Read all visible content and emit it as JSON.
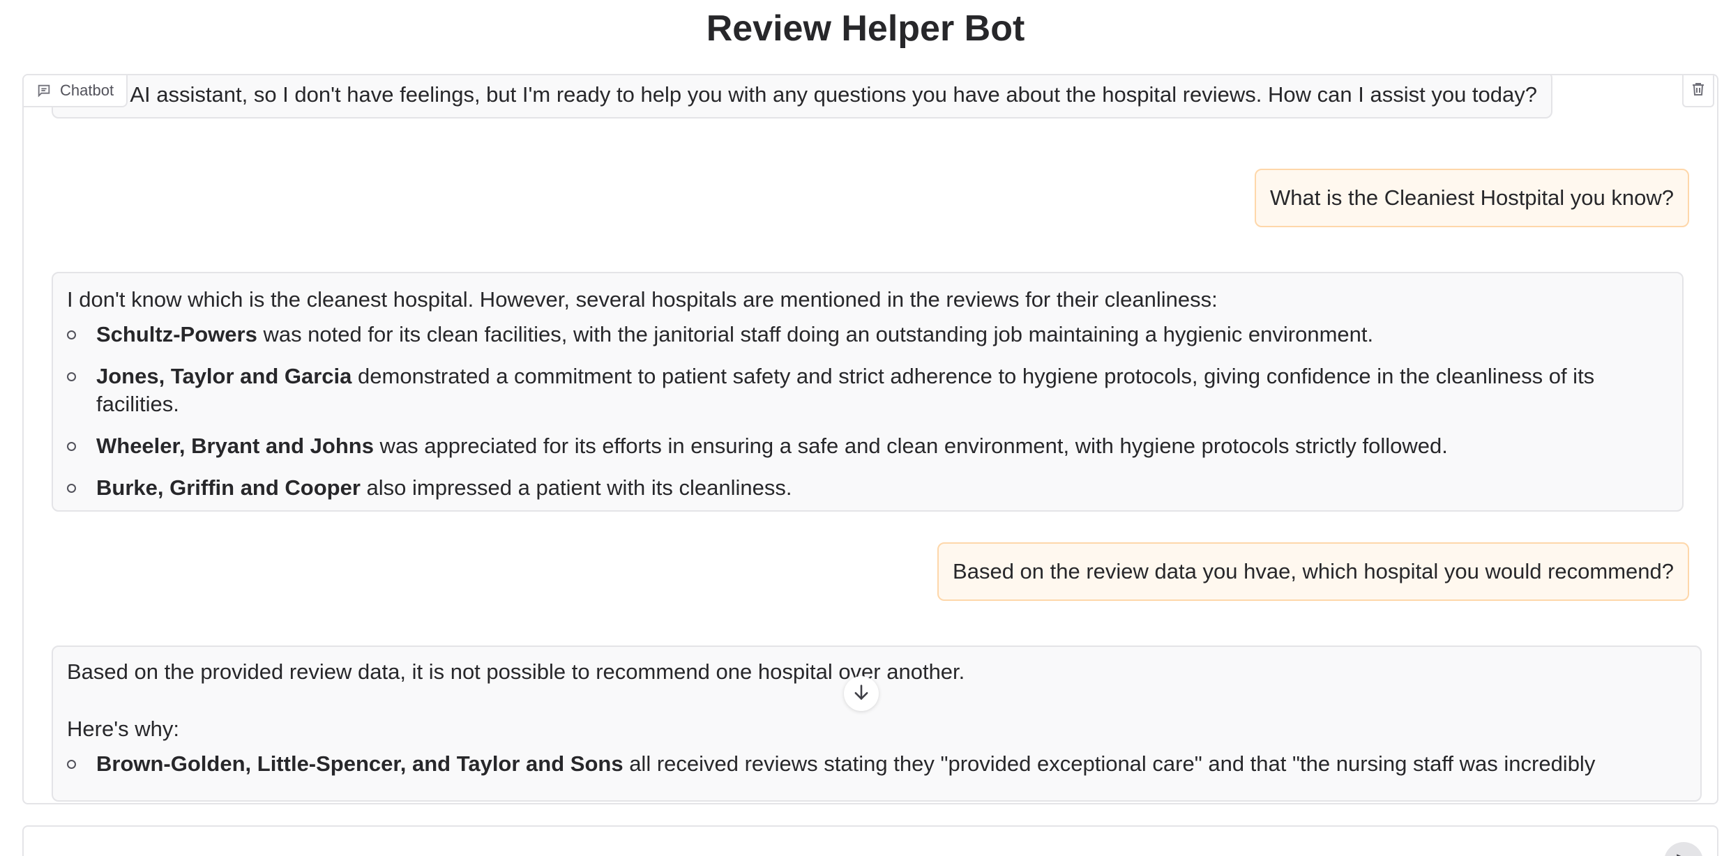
{
  "app": {
    "title": "Review Helper Bot"
  },
  "chatbot": {
    "label": "Chatbot",
    "label_icon": "chat-bubble-icon",
    "clear_icon": "trash-icon",
    "messages": [
      {
        "role": "bot",
        "text": "I'm an AI assistant, so I don't have feelings, but I'm ready to help you with any questions you have about the hospital reviews. How can I assist you today?"
      },
      {
        "role": "user",
        "text": "What is the Cleaniest Hostpital you know?"
      },
      {
        "role": "bot",
        "intro": "I don't know which is the cleanest hospital. However, several hospitals are mentioned in the reviews for their cleanliness:",
        "items": [
          {
            "name": "Schultz-Powers",
            "rest": " was noted for its clean facilities, with the janitorial staff doing an outstanding job maintaining a hygienic environment."
          },
          {
            "name": "Jones, Taylor and Garcia",
            "rest": " demonstrated a commitment to patient safety and strict adherence to hygiene protocols, giving confidence in the cleanliness of its facilities."
          },
          {
            "name": "Wheeler, Bryant and Johns",
            "rest": " was appreciated for its efforts in ensuring a safe and clean environment, with hygiene protocols strictly followed."
          },
          {
            "name": "Burke, Griffin and Cooper",
            "rest": " also impressed a patient with its cleanliness."
          }
        ]
      },
      {
        "role": "user",
        "text": "Based on the review data you hvae, which hospital you would recommend?"
      },
      {
        "role": "bot",
        "intro": "Based on the provided review data, it is not possible to recommend one hospital over another.",
        "para2": "Here's why:",
        "items": [
          {
            "name": "Brown-Golden, Little-Spencer, and Taylor and Sons",
            "rest": " all received reviews stating they \"provided exceptional care\" and that \"the nursing staff was incredibly"
          }
        ]
      }
    ]
  },
  "scroll_down_icon": "arrow-down-icon",
  "input": {
    "send_icon": "send-arrow-icon"
  }
}
